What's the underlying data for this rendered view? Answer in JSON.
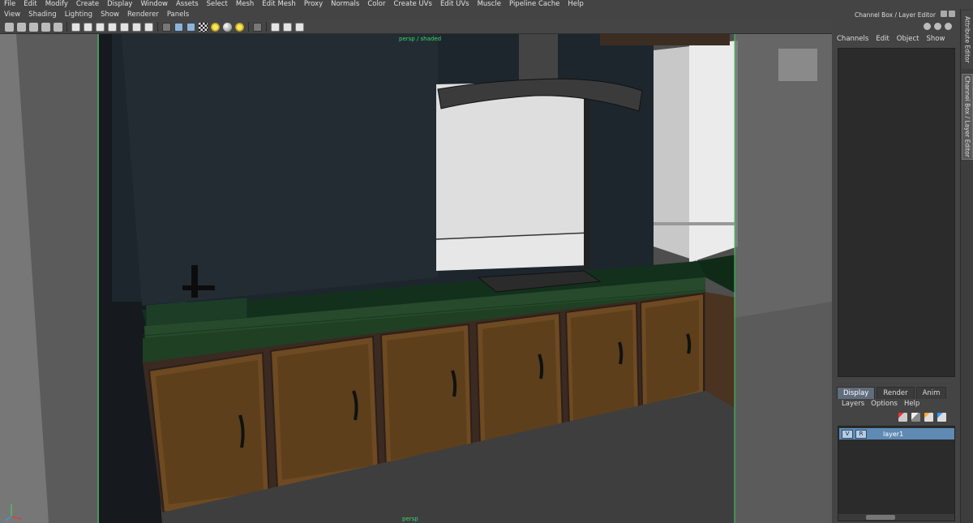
{
  "main_menu": [
    "File",
    "Edit",
    "Modify",
    "Create",
    "Display",
    "Window",
    "Assets",
    "Select",
    "Mesh",
    "Edit Mesh",
    "Proxy",
    "Normals",
    "Color",
    "Create UVs",
    "Edit UVs",
    "Muscle",
    "Pipeline Cache",
    "Help"
  ],
  "panel_menu": [
    "View",
    "Shading",
    "Lighting",
    "Show",
    "Renderer",
    "Panels"
  ],
  "viewport": {
    "hud_top": "persp / shaded",
    "camera_label": "persp"
  },
  "dock": {
    "title": "Channel Box / Layer Editor",
    "channel_menu": [
      "Channels",
      "Edit",
      "Object",
      "Show"
    ],
    "side_tabs": {
      "attribute": "Attribute Editor",
      "channel": "Channel Box / Layer Editor"
    },
    "layer_tabs": [
      "Display",
      "Render",
      "Anim"
    ],
    "layer_menu": [
      "Layers",
      "Options",
      "Help"
    ],
    "layer": {
      "v": "V",
      "r": "R",
      "name": "layer1"
    }
  }
}
